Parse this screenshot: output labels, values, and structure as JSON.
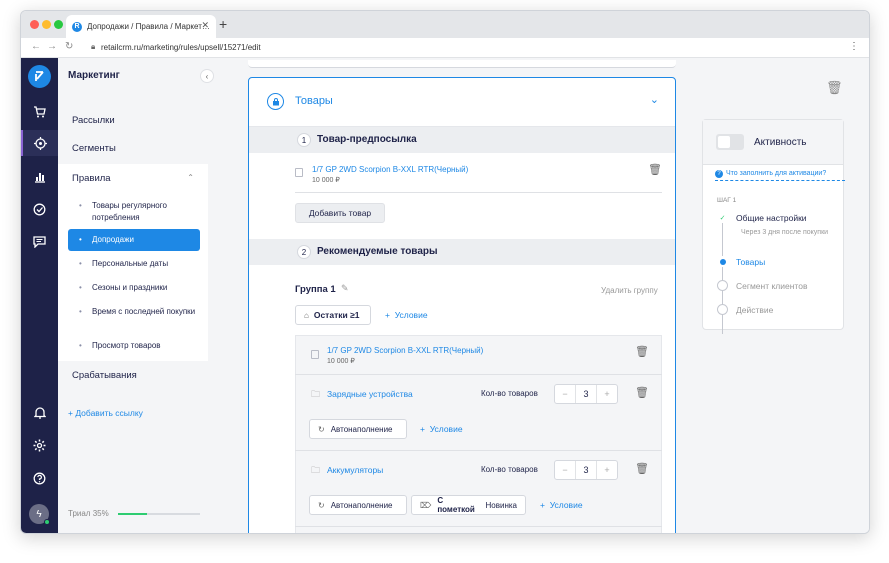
{
  "browser": {
    "tab_title": "Допродажи / Правила / Маркет…",
    "tab_close": "✕",
    "new_tab": "+",
    "url": "retailcrm.ru/marketing/rules/upsell/15271/edit"
  },
  "rail": {
    "logo_letter": "R",
    "icons": [
      "cart-icon",
      "target-icon",
      "chart-icon",
      "check-circle-icon",
      "chat-icon",
      "bell-icon",
      "gear-icon",
      "help-icon"
    ]
  },
  "sidebar": {
    "title": "Маркетинг",
    "items": [
      "Рассылки",
      "Сегменты",
      "Срабатывания"
    ],
    "group_title": "Правила",
    "sub_items": [
      "Товары регулярного потребления",
      "Допродажи",
      "Персональные даты",
      "Сезоны и праздники",
      "Время с последней покупки",
      "Просмотр товаров"
    ],
    "add_link": "Добавить ссылку",
    "trial_label": "Триал 35%",
    "trial_progress": 0.35
  },
  "main": {
    "card_title": "Товары",
    "section1": {
      "num": "1",
      "label": "Товар-предпосылка"
    },
    "product": {
      "name": "1/7 GP 2WD Scorpion B-XXL RTR(Черный)",
      "price": "10 000 ₽"
    },
    "add_product": "Добавить товар",
    "section2": {
      "num": "2",
      "label": "Рекомендуемые товары"
    },
    "group_label": "Группа 1",
    "delete_group": "Удалить группу",
    "stock_button": "Остатки ≥1",
    "add_condition": "Условие",
    "group_product": {
      "name": "1/7 GP 2WD Scorpion B-XXL RTR(Черный)",
      "price": "10 000 ₽"
    },
    "categories": [
      {
        "name": "Зарядные устройства",
        "qty_label": "Кол-во товаров",
        "qty": "3",
        "autofill": "Автонаполнение",
        "tag": ""
      },
      {
        "name": "Аккумуляторы",
        "qty_label": "Кол-во товаров",
        "qty": "3",
        "autofill": "Автонаполнение",
        "tag_bold": "С пометкой",
        "tag": "Новинка"
      }
    ]
  },
  "right": {
    "activity_label": "Активность",
    "hint": "Что заполнить для активации?",
    "step_label": "ШАГ 1",
    "steps": [
      {
        "label": "Общие настройки",
        "sub": "Через 3 дня после покупки",
        "state": "done"
      },
      {
        "label": "Товары",
        "state": "active"
      },
      {
        "label": "Сегмент клиентов",
        "state": "pending"
      },
      {
        "label": "Действие",
        "state": "pending"
      }
    ]
  },
  "colors": {
    "accent": "#1e88e5",
    "rail": "#1e2248",
    "success": "#2ecc71"
  }
}
